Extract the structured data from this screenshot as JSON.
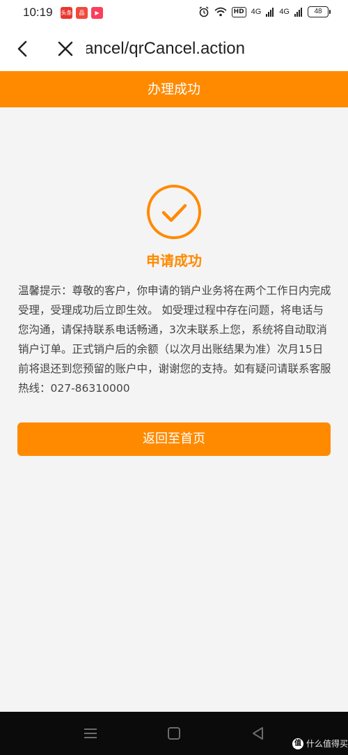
{
  "status_bar": {
    "time": "10:19",
    "app_icons": [
      {
        "name": "toutiao-app-icon",
        "label": "头条",
        "color": "#e8372f"
      },
      {
        "name": "meituan-app-icon",
        "label": "品",
        "color": "#f0493d"
      },
      {
        "name": "video-app-icon",
        "label": "▶",
        "color": "#fa3f5e"
      }
    ],
    "hd_label": "HD",
    "signal1": "4G",
    "signal2": "4G",
    "battery": "48"
  },
  "nav": {
    "url": "cancel/qrCancel.action"
  },
  "title_bar": {
    "title": "办理成功",
    "color": "#ff8a00"
  },
  "content": {
    "success_title": "申请成功",
    "notice": "温馨提示：尊敬的客户，你申请的销户业务将在两个工作日内完成受理，受理成功后立即生效。 如受理过程中存在问题，将电话与您沟通，请保持联系电话畅通，3次未联系上您，系统将自动取消销户订单。正式销户后的余额（以次月出账结果为准）次月15日前将退还到您预留的账户中，谢谢您的支持。如有疑问请联系客服热线：027-86310000",
    "home_button": "返回至首页"
  },
  "watermark": {
    "badge": "值",
    "text": "什么值得买"
  }
}
